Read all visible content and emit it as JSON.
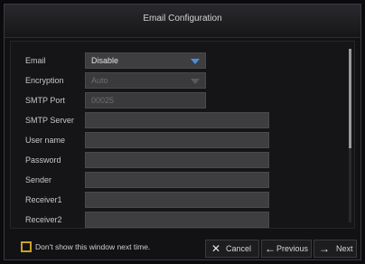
{
  "window": {
    "title": "Email Configuration"
  },
  "form": {
    "email": {
      "label": "Email",
      "value": "Disable"
    },
    "encryption": {
      "label": "Encryption",
      "value": "Auto"
    },
    "smtp_port": {
      "label": "SMTP Port",
      "value": "00025"
    },
    "smtp_server": {
      "label": "SMTP Server",
      "value": ""
    },
    "user_name": {
      "label": "User name",
      "value": ""
    },
    "password": {
      "label": "Password",
      "value": ""
    },
    "sender": {
      "label": "Sender",
      "value": ""
    },
    "receiver1": {
      "label": "Receiver1",
      "value": ""
    },
    "receiver2": {
      "label": "Receiver2",
      "value": ""
    }
  },
  "footer": {
    "dont_show_label": "Don't show this window next time.",
    "cancel_label": "Cancel",
    "previous_label": "Previous",
    "next_label": "Next"
  },
  "icons": {
    "cancel": "x-icon",
    "previous": "arrow-left-icon",
    "next": "arrow-right-icon",
    "dropdown": "chevron-down-icon"
  },
  "colors": {
    "accent_arrow": "#4a8fe0",
    "checkbox": "#c9a227"
  }
}
